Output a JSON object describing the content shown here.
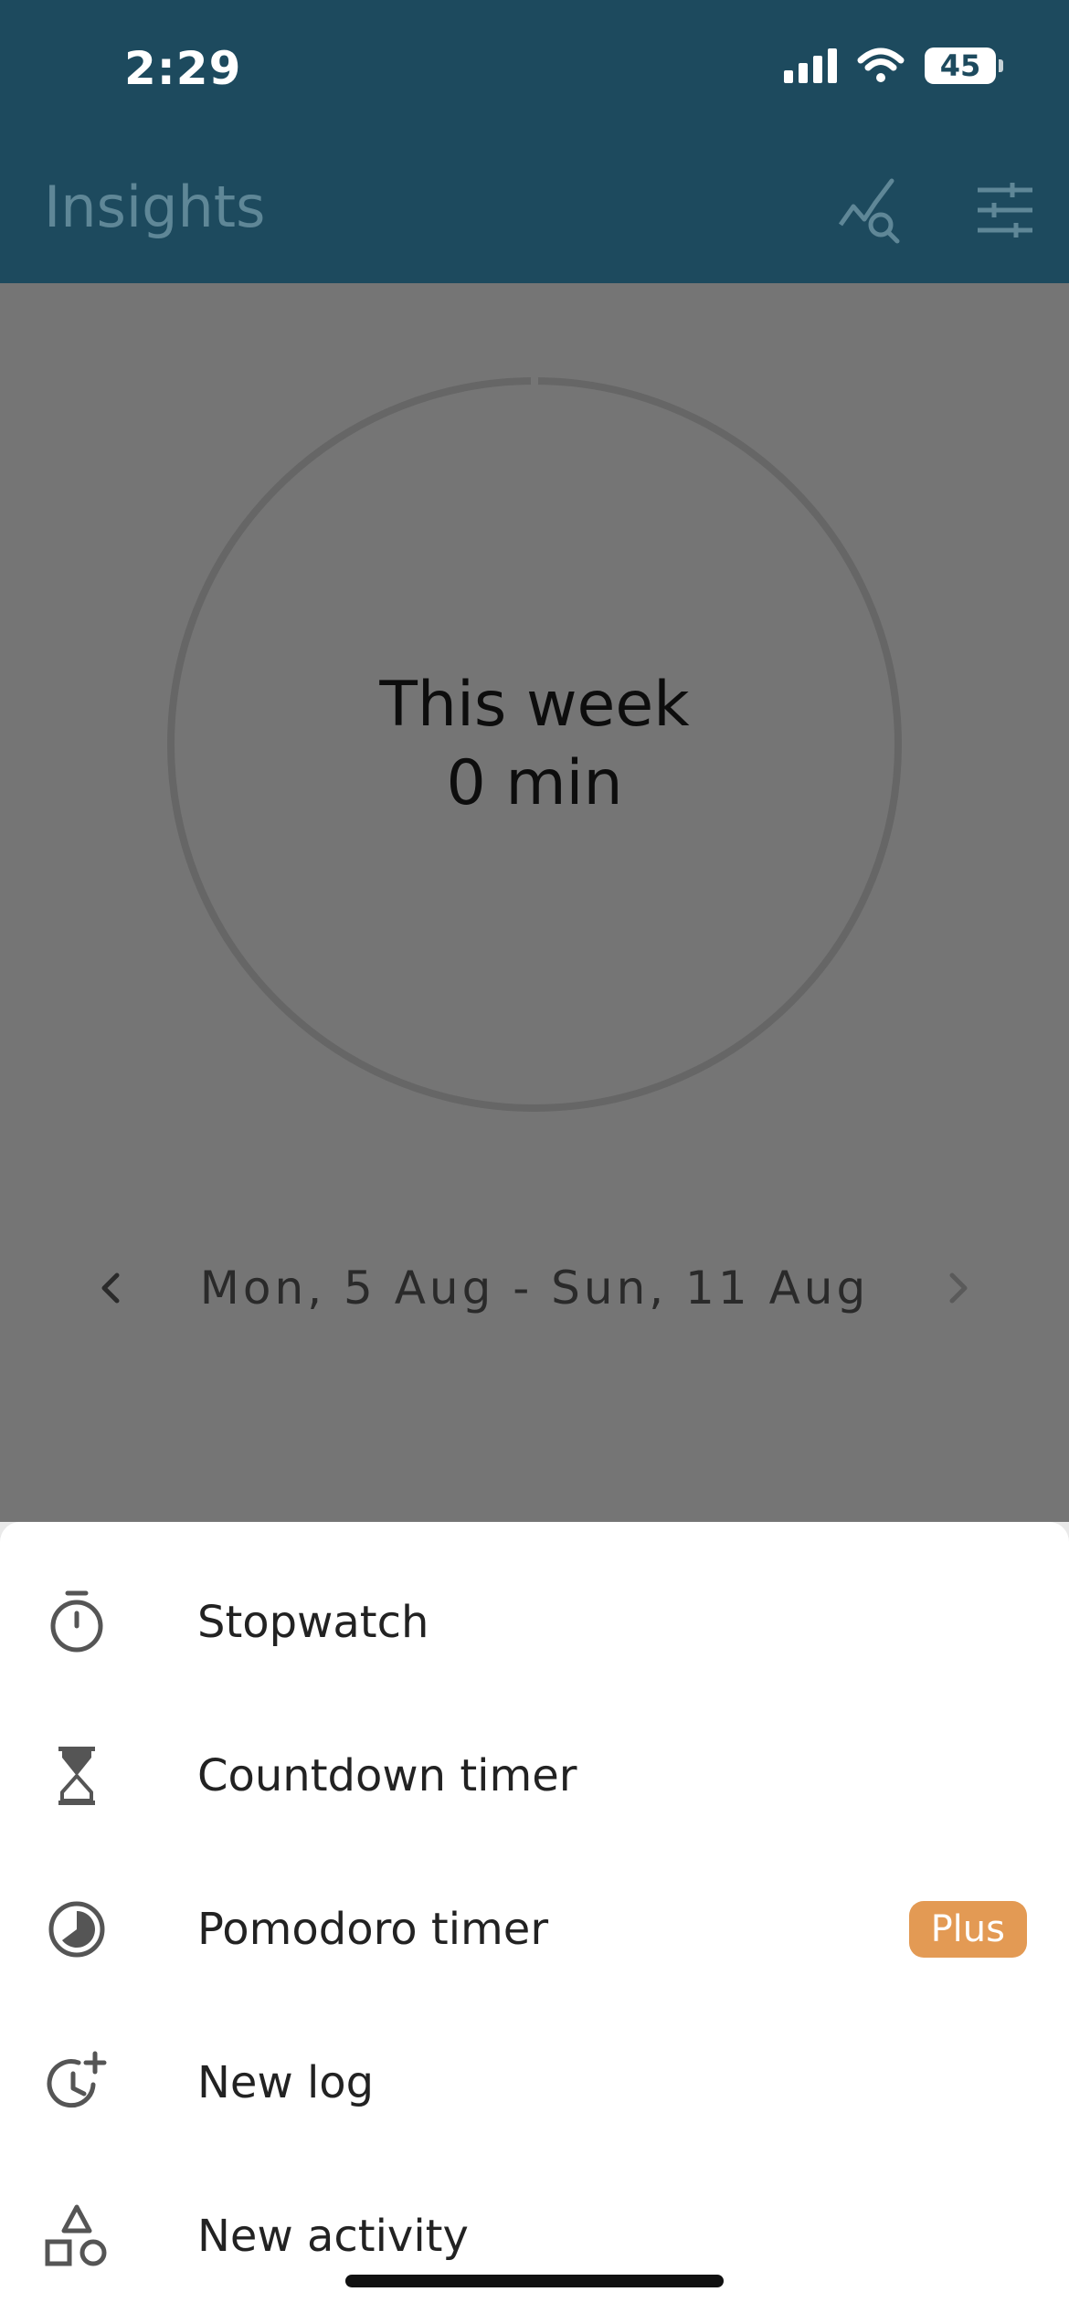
{
  "status_bar": {
    "time": "2:29",
    "battery": "45"
  },
  "header": {
    "title": "Insights",
    "icons": [
      "chart-search-icon",
      "sliders-icon"
    ]
  },
  "summary": {
    "period_label": "This week",
    "total": "0 min"
  },
  "date_range": {
    "label": "Mon, 5 Aug - Sun, 11 Aug"
  },
  "menu": {
    "items": [
      {
        "label": "Stopwatch",
        "icon": "stopwatch-icon"
      },
      {
        "label": "Countdown timer",
        "icon": "hourglass-icon"
      },
      {
        "label": "Pomodoro timer",
        "icon": "pomodoro-icon",
        "badge": "Plus"
      },
      {
        "label": "New log",
        "icon": "clock-plus-icon"
      },
      {
        "label": "New activity",
        "icon": "shapes-icon"
      }
    ]
  },
  "colors": {
    "header_bg": "#1d4a5e",
    "overlay": "#757575",
    "badge": "#e39a54"
  }
}
